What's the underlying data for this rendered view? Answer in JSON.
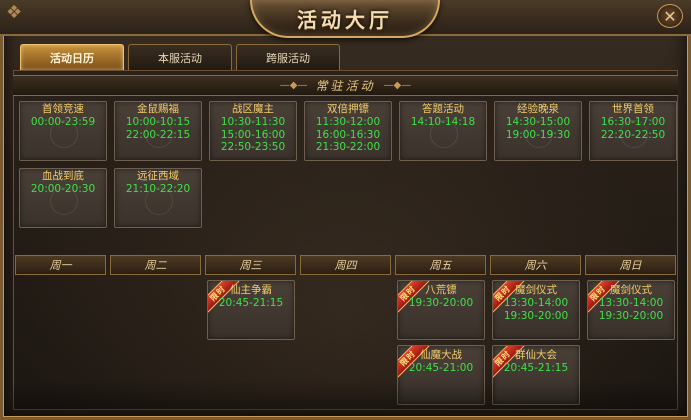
{
  "window": {
    "title": "活动大厅",
    "close_icon": "close-icon"
  },
  "tabs": [
    {
      "label": "活动日历",
      "active": true
    },
    {
      "label": "本服活动",
      "active": false
    },
    {
      "label": "跨服活动",
      "active": false
    }
  ],
  "daily_section": {
    "title": "常驻活动"
  },
  "daily_activities": [
    {
      "name": "首领竞速",
      "times": [
        "00:00-23:59"
      ]
    },
    {
      "name": "金鼠赐福",
      "times": [
        "10:00-10:15",
        "22:00-22:15"
      ]
    },
    {
      "name": "战区魔主",
      "times": [
        "10:30-11:30",
        "15:00-16:00",
        "22:50-23:50"
      ]
    },
    {
      "name": "双倍押镖",
      "times": [
        "11:30-12:00",
        "16:00-16:30",
        "21:30-22:00"
      ]
    },
    {
      "name": "答题活动",
      "times": [
        "14:10-14:18"
      ]
    },
    {
      "name": "经验晚泉",
      "times": [
        "14:30-15:00",
        "19:00-19:30"
      ]
    },
    {
      "name": "世界首领",
      "times": [
        "16:30-17:00",
        "22:20-22:50"
      ]
    },
    {
      "name": "血战到底",
      "times": [
        "20:00-20:30"
      ]
    },
    {
      "name": "远征西域",
      "times": [
        "21:10-22:20"
      ]
    }
  ],
  "weekdays": [
    "周一",
    "周二",
    "周三",
    "周四",
    "周五",
    "周六",
    "周日"
  ],
  "ribbon_label": "限时",
  "weekly_activities": [
    {
      "day": 2,
      "row": 0,
      "name": "仙主争霸",
      "times": [
        "20:45-21:15"
      ]
    },
    {
      "day": 4,
      "row": 0,
      "name": "八荒镖",
      "times": [
        "19:30-20:00"
      ]
    },
    {
      "day": 5,
      "row": 0,
      "name": "魔剑仪式",
      "times": [
        "13:30-14:00",
        "19:30-20:00"
      ]
    },
    {
      "day": 6,
      "row": 0,
      "name": "魔剑仪式",
      "times": [
        "13:30-14:00",
        "19:30-20:00"
      ]
    },
    {
      "day": 4,
      "row": 1,
      "name": "仙魔大战",
      "times": [
        "20:45-21:00"
      ]
    },
    {
      "day": 5,
      "row": 1,
      "name": "群仙大会",
      "times": [
        "20:45-21:15"
      ]
    }
  ]
}
